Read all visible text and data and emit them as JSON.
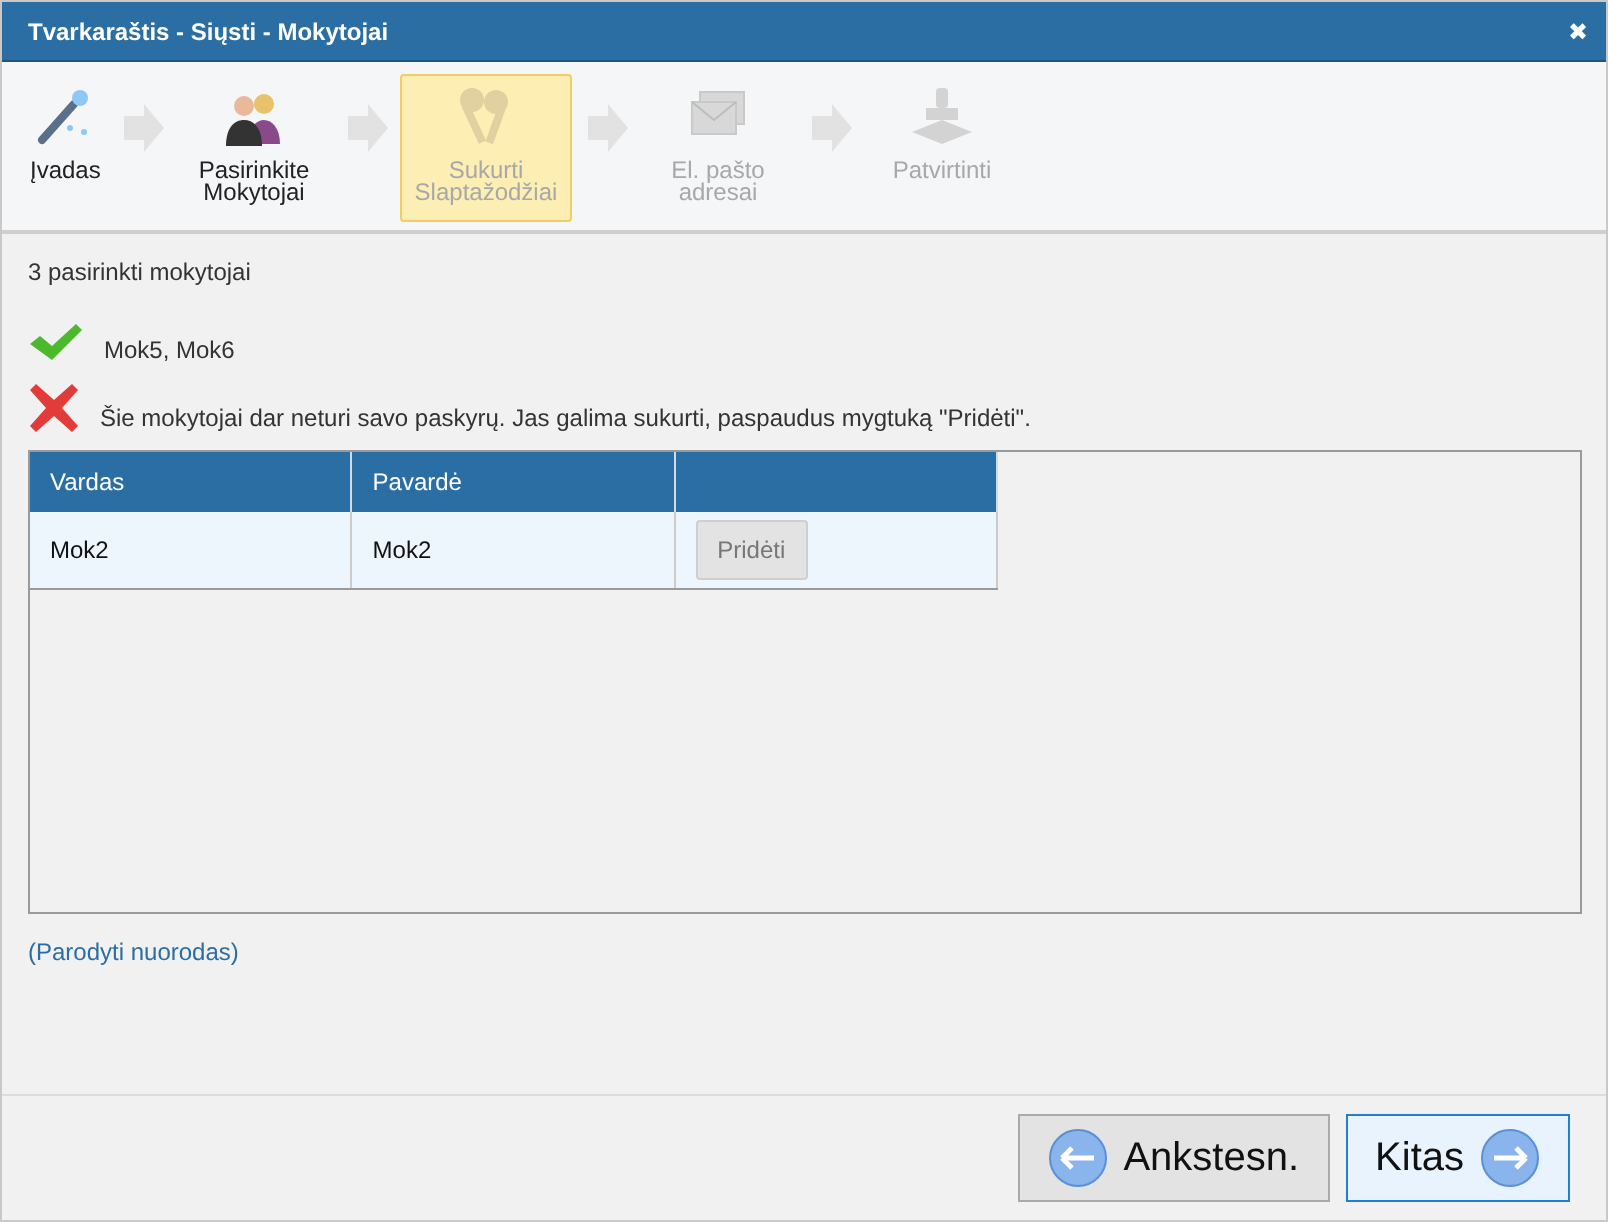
{
  "window": {
    "title": "Tvarkaraštis - Siųsti - Mokytojai",
    "close": "✖"
  },
  "steps": [
    {
      "label": "Įvadas",
      "kind": "wand",
      "selected": false,
      "disabled": false
    },
    {
      "label": "Pasirinkite Mokytojai",
      "kind": "people",
      "selected": false,
      "disabled": false
    },
    {
      "label": "Sukurti Slaptažodžiai",
      "kind": "keys",
      "selected": true,
      "disabled": true
    },
    {
      "label": "El. pašto adresai",
      "kind": "mail",
      "selected": false,
      "disabled": true
    },
    {
      "label": "Patvirtinti",
      "kind": "stamp",
      "selected": false,
      "disabled": true
    }
  ],
  "summary": "3 pasirinkti mokytojai",
  "messages": [
    {
      "kind": "ok",
      "text": "Mok5, Mok6"
    },
    {
      "kind": "error",
      "text": "Šie mokytojai dar neturi savo paskyrų. Jas galima sukurti, paspaudus mygtuką \"Pridėti\"."
    }
  ],
  "table": {
    "columns": [
      "Vardas",
      "Pavardė"
    ],
    "rows": [
      {
        "cells": [
          "Mok2",
          "Mok2"
        ],
        "button": {
          "label": "Pridėti",
          "disabled": true
        }
      }
    ]
  },
  "link": "(Parodyti nuorodas)",
  "buttons": [
    {
      "label": "Ankstesn.",
      "kind": "back",
      "selected": false
    },
    {
      "label": "Kitas",
      "kind": "next",
      "selected": true
    }
  ]
}
